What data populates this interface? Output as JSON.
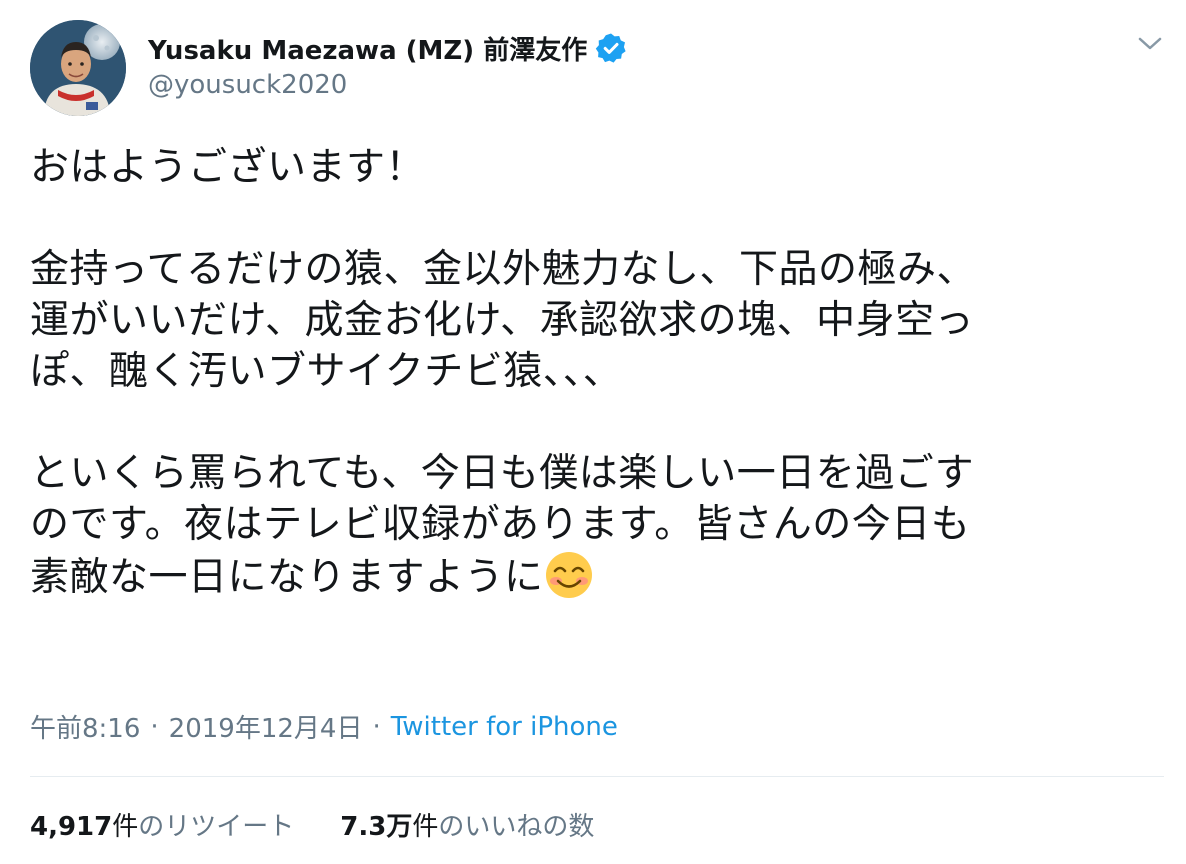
{
  "user": {
    "display_name": "Yusaku Maezawa (MZ) 前澤友作",
    "handle": "@yousuck2020",
    "verified": true,
    "verified_icon": "verified-badge-icon",
    "avatar_icon": "astronaut-avatar"
  },
  "tweet": {
    "line1": "おはようございます！",
    "line2": "金持ってるだけの猿、金以外魅力なし、下品の極み、",
    "line3": "運がいいだけ、成金お化け、承認欲求の塊、中身空っ",
    "line4": "ぽ、醜く汚いブサイクチビ猿、、、",
    "line5": "といくら罵られても、今日も僕は楽しい一日を過ごす",
    "line6": "のです。夜はテレビ収録があります。皆さんの今日も",
    "line7": "素敵な一日になりますように",
    "emoji": "smiling-face-with-smiling-eyes"
  },
  "meta": {
    "time": "午前8:16",
    "separator": "·",
    "date": "2019年12月4日",
    "separator2": "·",
    "source": "Twitter for iPhone"
  },
  "stats": {
    "retweets_count": "4,917",
    "retweets_unit": "件",
    "retweets_label": "のリツイート",
    "likes_count": "7.3万",
    "likes_unit": "件",
    "likes_label": "のいいねの数"
  },
  "colors": {
    "text": "#14171a",
    "secondary": "#657786",
    "link": "#1b95e0",
    "verified": "#1da1f2",
    "divider": "#e6ecf0"
  }
}
